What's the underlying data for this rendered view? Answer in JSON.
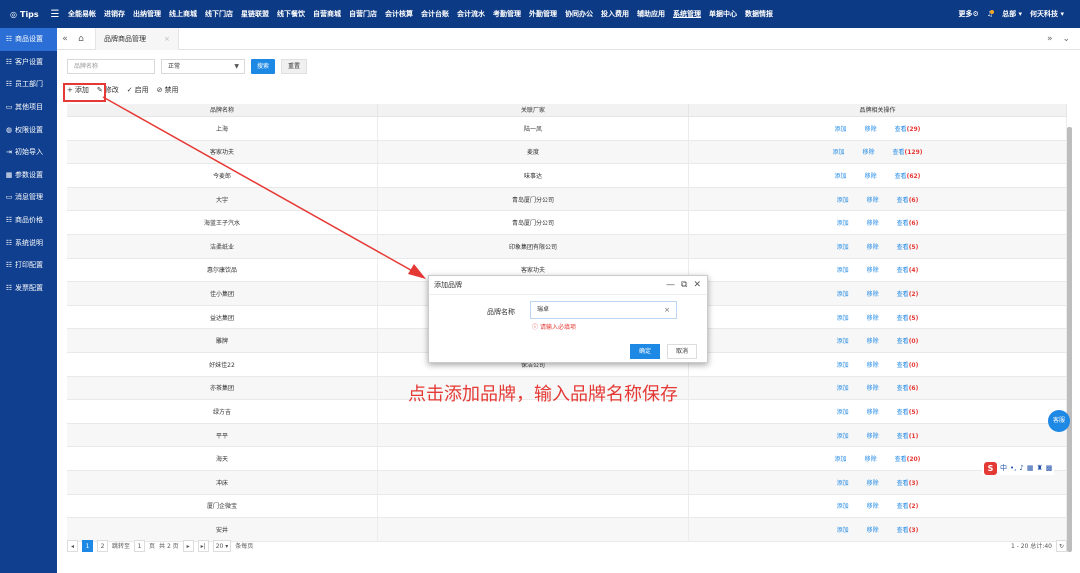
{
  "top": {
    "brand": "Tips",
    "nav": [
      "全能易帐",
      "进销存",
      "出纳管理",
      "线上商城",
      "线下门店",
      "星链联盟",
      "线下餐饮",
      "自营商城",
      "自营门店",
      "会计核算",
      "会计台账",
      "会计流水",
      "考勤管理",
      "外勤管理",
      "协同办公",
      "投入费用",
      "辅助应用",
      "系统管理",
      "单据中心",
      "数据情报"
    ],
    "active_nav": "系统管理",
    "more": "更多",
    "org": "总部",
    "company": "何天科技"
  },
  "sidebar": {
    "items": [
      {
        "icon": "☷",
        "label": "商品设置"
      },
      {
        "icon": "☷",
        "label": "客户设置"
      },
      {
        "icon": "☷",
        "label": "员工部门"
      },
      {
        "icon": "▭",
        "label": "其他项目"
      },
      {
        "icon": "◍",
        "label": "权限设置"
      },
      {
        "icon": "⇥",
        "label": "初始导入"
      },
      {
        "icon": "▦",
        "label": "参数设置"
      },
      {
        "icon": "▭",
        "label": "消息管理"
      },
      {
        "icon": "☷",
        "label": "商品价格"
      },
      {
        "icon": "☷",
        "label": "系统说明"
      },
      {
        "icon": "☷",
        "label": "打印配置"
      },
      {
        "icon": "☷",
        "label": "发票配置"
      }
    ]
  },
  "tabs": {
    "current": "品牌商品管理"
  },
  "filter": {
    "brand_placeholder": "品牌名称",
    "status_value": "正常",
    "search_label": "搜索",
    "reset_label": "重置"
  },
  "toolbar": {
    "add": "添加",
    "edit": "修改",
    "enable": "启用",
    "disable": "禁用"
  },
  "table": {
    "headers": [
      "品牌名称",
      "关联厂家",
      "品牌相关操作"
    ],
    "op_add": "添加",
    "op_remove": "移除",
    "op_view": "查看",
    "rows": [
      {
        "name": "上海",
        "vendor": "陆一凤",
        "count": "(29)"
      },
      {
        "name": "客家功夫",
        "vendor": "麦度",
        "count": "(129)"
      },
      {
        "name": "今麦郎",
        "vendor": "味事达",
        "count": "(62)"
      },
      {
        "name": "大宇",
        "vendor": "青岛厦门分公司",
        "count": "(6)"
      },
      {
        "name": "海蓝王子汽水",
        "vendor": "青岛厦门分公司",
        "count": "(6)"
      },
      {
        "name": "洁柔纸业",
        "vendor": "印象集团有限公司",
        "count": "(5)"
      },
      {
        "name": "惠尔康饮品",
        "vendor": "客家功夫",
        "count": "(4)"
      },
      {
        "name": "佳小集团",
        "vendor": "",
        "count": "(2)"
      },
      {
        "name": "益达集团",
        "vendor": "",
        "count": "(5)"
      },
      {
        "name": "雕牌",
        "vendor": "",
        "count": "(0)"
      },
      {
        "name": "好妹佳22",
        "vendor": "保洁公司",
        "count": "(0)"
      },
      {
        "name": "亦茶集团",
        "vendor": "",
        "count": "(6)"
      },
      {
        "name": "绿方吉",
        "vendor": "",
        "count": "(5)"
      },
      {
        "name": "平平",
        "vendor": "",
        "count": "(1)"
      },
      {
        "name": "海天",
        "vendor": "",
        "count": "(20)"
      },
      {
        "name": "冲床",
        "vendor": "",
        "count": "(3)"
      },
      {
        "name": "厦门企微宝",
        "vendor": "",
        "count": "(2)"
      },
      {
        "name": "安井",
        "vendor": "",
        "count": "(3)"
      }
    ]
  },
  "pager": {
    "pages": [
      "1",
      "2"
    ],
    "jump_label": "跳转至",
    "jump_value": "1",
    "page_unit": "页",
    "total_pages": "共 2 页",
    "page_size": "20",
    "per_page": "条每页",
    "summary": "1 - 20 总计:40"
  },
  "modal": {
    "title": "添加品牌",
    "label": "品牌名称",
    "value": "瑞卓",
    "error": "请输入必填项",
    "ok": "确定",
    "cancel": "取消"
  },
  "annotation": "点击添加品牌，输入品牌名称保存",
  "service_label": "客服",
  "ime": {
    "lang": "中"
  },
  "colors": {
    "primary": "#1e88e5",
    "nav": "#0d3a84",
    "sidebar_active": "#2b6fd6",
    "annotation": "#e53935"
  }
}
